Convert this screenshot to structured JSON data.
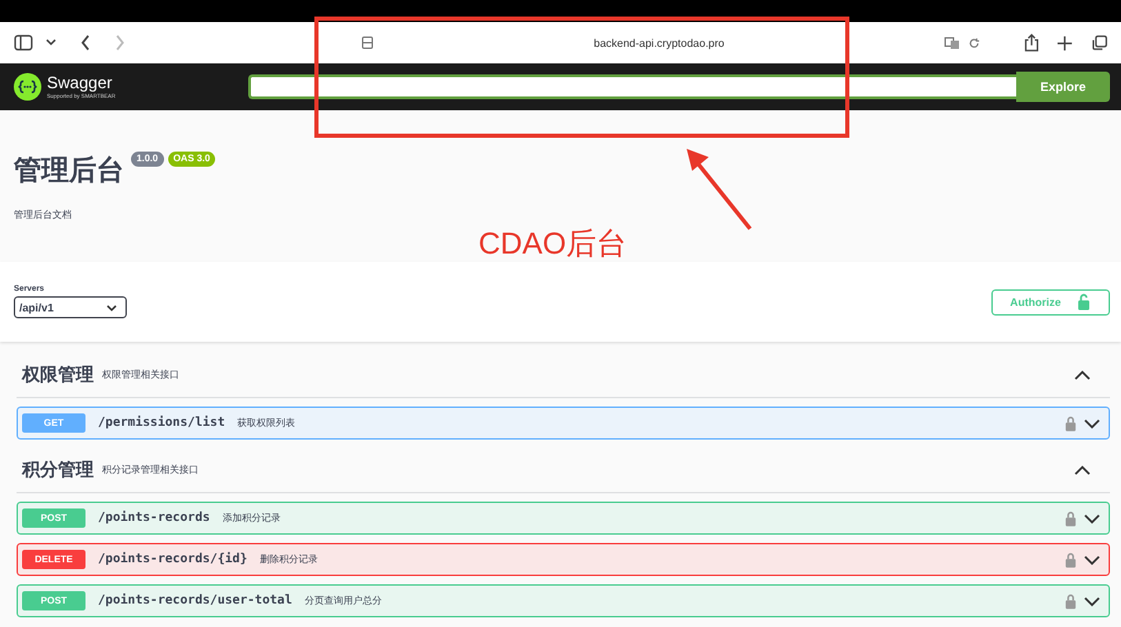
{
  "browser": {
    "url": "backend-api.cryptodao.pro"
  },
  "header": {
    "brand": "Swagger",
    "tagline": "Supported by SMARTBEAR",
    "explore_button": "Explore"
  },
  "info": {
    "title": "管理后台",
    "version": "1.0.0",
    "oas": "OAS 3.0",
    "description": "管理后台文档"
  },
  "servers": {
    "label": "Servers",
    "value": "/api/v1",
    "authorize_button": "Authorize"
  },
  "sections": [
    {
      "name": "权限管理",
      "description": "权限管理相关接口",
      "expanded": true,
      "operations": [
        {
          "method": "GET",
          "path": "/permissions/list",
          "summary": "获取权限列表"
        }
      ]
    },
    {
      "name": "积分管理",
      "description": "积分记录管理相关接口",
      "expanded": true,
      "operations": [
        {
          "method": "POST",
          "path": "/points-records",
          "summary": "添加积分记录"
        },
        {
          "method": "DELETE",
          "path": "/points-records/{id}",
          "summary": "删除积分记录"
        },
        {
          "method": "POST",
          "path": "/points-records/user-total",
          "summary": "分页查询用户总分"
        }
      ]
    }
  ],
  "annotation": {
    "label": "CDAO后台"
  }
}
